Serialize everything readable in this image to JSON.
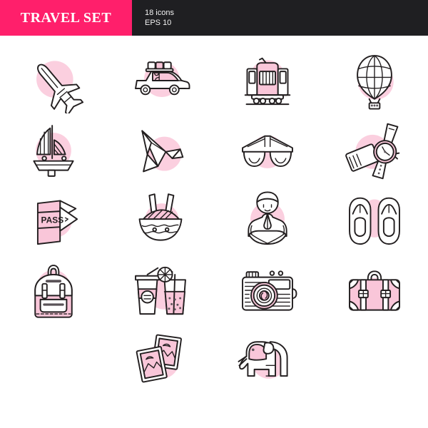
{
  "header": {
    "brand_title": "TRAVEL SET",
    "icon_count_label": "18 icons",
    "format_label": "EPS 10",
    "brand_bg": "#ff1f6b",
    "bar_bg": "#1f1f22",
    "brand_text_color": "#ffffff"
  },
  "palette": {
    "blob_pink": "#fbcfdf",
    "fill_pink": "#f9c6d9",
    "stroke_dark": "#231f20",
    "white": "#ffffff"
  },
  "grid": {
    "columns": 4,
    "rows": 5,
    "total_icons": 18
  },
  "icons": [
    {
      "id": "airplane",
      "name": "airplane-icon",
      "label": "Airplane",
      "row": 1,
      "col": 1,
      "blob": true
    },
    {
      "id": "taxi",
      "name": "taxi-car-icon",
      "label": "Taxi with luggage",
      "row": 1,
      "col": 2,
      "blob": true
    },
    {
      "id": "tram",
      "name": "tram-icon",
      "label": "Tram",
      "row": 1,
      "col": 3,
      "blob": true
    },
    {
      "id": "balloon",
      "name": "hot-air-balloon-icon",
      "label": "Hot air balloon",
      "row": 1,
      "col": 4,
      "blob": true
    },
    {
      "id": "sailboat",
      "name": "sailboat-icon",
      "label": "Sailboat",
      "row": 2,
      "col": 1,
      "blob": true
    },
    {
      "id": "paper-crane",
      "name": "paper-crane-icon",
      "label": "Origami paper crane",
      "row": 2,
      "col": 2,
      "blob": true
    },
    {
      "id": "sunglasses",
      "name": "sunglasses-icon",
      "label": "Sunglasses",
      "row": 2,
      "col": 3,
      "blob": true
    },
    {
      "id": "watch-card",
      "name": "wristwatch-icon",
      "label": "Wristwatch and card",
      "row": 2,
      "col": 4,
      "blob": true
    },
    {
      "id": "passport",
      "name": "passport-icon",
      "label": "Passport",
      "row": 3,
      "col": 1,
      "blob": true,
      "text": "PASS"
    },
    {
      "id": "noodle-bowl",
      "name": "noodle-bowl-icon",
      "label": "Noodle bowl",
      "row": 3,
      "col": 2,
      "blob": true
    },
    {
      "id": "yoga",
      "name": "yoga-meditation-icon",
      "label": "Meditating person",
      "row": 3,
      "col": 3,
      "blob": true
    },
    {
      "id": "flipflops",
      "name": "flip-flops-icon",
      "label": "Flip flops",
      "row": 3,
      "col": 4,
      "blob": true
    },
    {
      "id": "backpack",
      "name": "backpack-icon",
      "label": "Backpack",
      "row": 4,
      "col": 1,
      "blob": true
    },
    {
      "id": "drinks",
      "name": "drinks-icon",
      "label": "Cold drinks",
      "row": 4,
      "col": 2,
      "blob": true
    },
    {
      "id": "camera",
      "name": "camera-icon",
      "label": "Photo camera",
      "row": 4,
      "col": 3,
      "blob": true
    },
    {
      "id": "suitcase",
      "name": "suitcase-icon",
      "label": "Suitcase",
      "row": 4,
      "col": 4,
      "blob": true
    },
    {
      "id": "photos",
      "name": "photographs-icon",
      "label": "Photographs",
      "row": 5,
      "col": 2,
      "blob": true
    },
    {
      "id": "elephant",
      "name": "elephant-icon",
      "label": "Elephant",
      "row": 5,
      "col": 3,
      "blob": true
    }
  ]
}
